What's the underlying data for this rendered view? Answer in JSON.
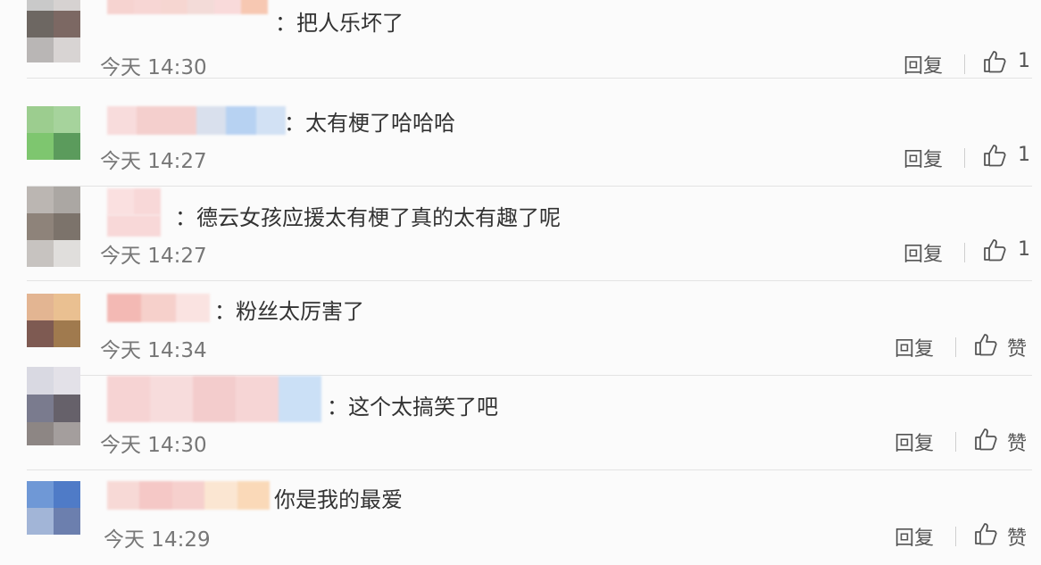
{
  "comments": [
    {
      "text": "：把人乐坏了",
      "time": "今天 14:30",
      "reply": "回复",
      "likes": "1",
      "avatar_colors": [
        "#c9c9c9",
        "#d6d2d1",
        "#6d6762",
        "#7c6863"
      ],
      "avatar_extra_colors": [
        "#b9b6b5",
        "#d8d4d3"
      ],
      "name_colors": [
        "#f6d3d0",
        "#f7d6d4",
        "#f6d6d1",
        "#f3dbd8",
        "#f9dada",
        "#f7c8b2"
      ]
    },
    {
      "text": "：太有梗了哈哈哈",
      "time": "今天 14:27",
      "reply": "回复",
      "likes": "1",
      "avatar_colors": [
        "#9ccd8f",
        "#a6d39c",
        "#7ec66f",
        "#5b9b5c"
      ],
      "avatar_extra_colors": [
        "#ffffff",
        "#ffffff"
      ],
      "name_colors": [
        "#f8dcdc",
        "#f4cfcd",
        "#f4cfcd",
        "#d9e0ed",
        "#b7d2f2",
        "#d2e1f4"
      ]
    },
    {
      "text": "：德云女孩应援太有梗了真的太有趣了呢",
      "time": "今天 14:27",
      "reply": "回复",
      "likes": "1",
      "avatar_colors": [
        "#bbb6b2",
        "#aba7a3",
        "#8e837a",
        "#7c736b"
      ],
      "avatar_extra_colors": [
        "#c7c3c0",
        "#e0dedc"
      ],
      "name_colors": [
        "#fae0e0",
        "#f8d8d8"
      ]
    },
    {
      "text": "：粉丝太厉害了",
      "time": "今天 14:34",
      "reply": "回复",
      "likes": "赞",
      "avatar_colors": [
        "#e3b592",
        "#eac091",
        "#7e5a52",
        "#a07a4e"
      ],
      "avatar_extra_colors": [
        "#ffffff",
        "#ffffff"
      ],
      "name_colors": [
        "#f3b9b4",
        "#f6d0cb",
        "#fae3e1"
      ]
    },
    {
      "text": "：这个太搞笑了吧",
      "time": "今天 14:30",
      "reply": "回复",
      "likes": "赞",
      "avatar_colors": [
        "#d9d9e2",
        "#e3e1e8",
        "#7a7b8e",
        "#66616a"
      ],
      "avatar_extra_colors": [
        "#8d8684",
        "#a49e9d"
      ],
      "name_colors": [
        "#f6d3d3",
        "#f7dcdc",
        "#f3cccc",
        "#f6d5d5",
        "#cbe0f6"
      ]
    },
    {
      "text": "你是我的最爱",
      "time": "今天 14:29",
      "reply": "回复",
      "likes": "赞",
      "avatar_colors": [
        "#6f98d6",
        "#4f7bc7",
        "#a2b5d7",
        "#6c7fae"
      ],
      "avatar_extra_colors": [
        "#ffffff",
        "#ffffff"
      ],
      "name_colors": [
        "#f7d9d6",
        "#f5c8c6",
        "#f6d0cd",
        "#fbe6d2",
        "#fad9b8"
      ]
    }
  ]
}
